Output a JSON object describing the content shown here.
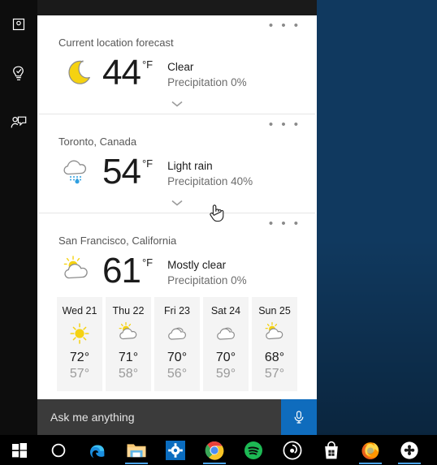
{
  "window": {
    "app_name": "Cortana",
    "rail_items": [
      {
        "name": "home-icon",
        "label": "Home"
      },
      {
        "name": "notebook-icon",
        "label": "Notebook"
      },
      {
        "name": "feedback-icon",
        "label": "Feedback"
      }
    ]
  },
  "cards": [
    {
      "title": "Current location forecast",
      "icon": "moon-icon",
      "temp": "44",
      "unit": "°F",
      "condition": "Clear",
      "precipitation": "Precipitation 0%",
      "overflow": "• • •",
      "expander": "chevron-down-icon"
    },
    {
      "title": "Toronto, Canada",
      "icon": "rain-cloud-icon",
      "temp": "54",
      "unit": "°F",
      "condition": "Light rain",
      "precipitation": "Precipitation 40%",
      "overflow": "• • •",
      "expander": "chevron-down-icon"
    },
    {
      "title": "San Francisco, California",
      "icon": "partly-cloudy-icon",
      "temp": "61",
      "unit": "°F",
      "condition": "Mostly clear",
      "precipitation": "Precipitation 0%",
      "overflow": "• • •"
    }
  ],
  "forecast": [
    {
      "day": "Wed 21",
      "icon": "sunny-icon",
      "high": "72°",
      "low": "57°"
    },
    {
      "day": "Thu 22",
      "icon": "partly-cloudy-icon",
      "high": "71°",
      "low": "58°"
    },
    {
      "day": "Fri 23",
      "icon": "cloudy-icon",
      "high": "70°",
      "low": "56°"
    },
    {
      "day": "Sat 24",
      "icon": "cloudy-icon",
      "high": "70°",
      "low": "59°"
    },
    {
      "day": "Sun 25",
      "icon": "partly-cloudy-icon",
      "high": "68°",
      "low": "57°"
    }
  ],
  "search": {
    "placeholder": "Ask me anything",
    "value": "",
    "mic_label": "microphone-icon"
  },
  "taskbar": {
    "items": [
      {
        "name": "start-button",
        "label": "Start",
        "running": false
      },
      {
        "name": "cortana-button",
        "label": "Cortana",
        "running": false
      },
      {
        "name": "edge-button",
        "label": "Microsoft Edge",
        "running": false
      },
      {
        "name": "file-explorer-button",
        "label": "File Explorer",
        "running": true
      },
      {
        "name": "settings-button",
        "label": "Settings",
        "running": false
      },
      {
        "name": "chrome-button",
        "label": "Google Chrome",
        "running": true
      },
      {
        "name": "spotify-button",
        "label": "Spotify",
        "running": false
      },
      {
        "name": "groove-button",
        "label": "Groove Music",
        "running": false
      },
      {
        "name": "store-button",
        "label": "Microsoft Store",
        "running": false
      },
      {
        "name": "firefox-button",
        "label": "Mozilla Firefox",
        "running": true
      },
      {
        "name": "app-button",
        "label": "App",
        "running": true
      }
    ]
  },
  "colors": {
    "accent": "#0f6cbd",
    "panel_bg": "#ffffff",
    "rail_bg": "#0d0d0d",
    "search_bg": "#3b3b3b",
    "taskbar_bg": "#000000",
    "sun_yellow": "#f5d211",
    "rain_blue": "#2f9fe0",
    "cloud_gray": "#808080"
  }
}
